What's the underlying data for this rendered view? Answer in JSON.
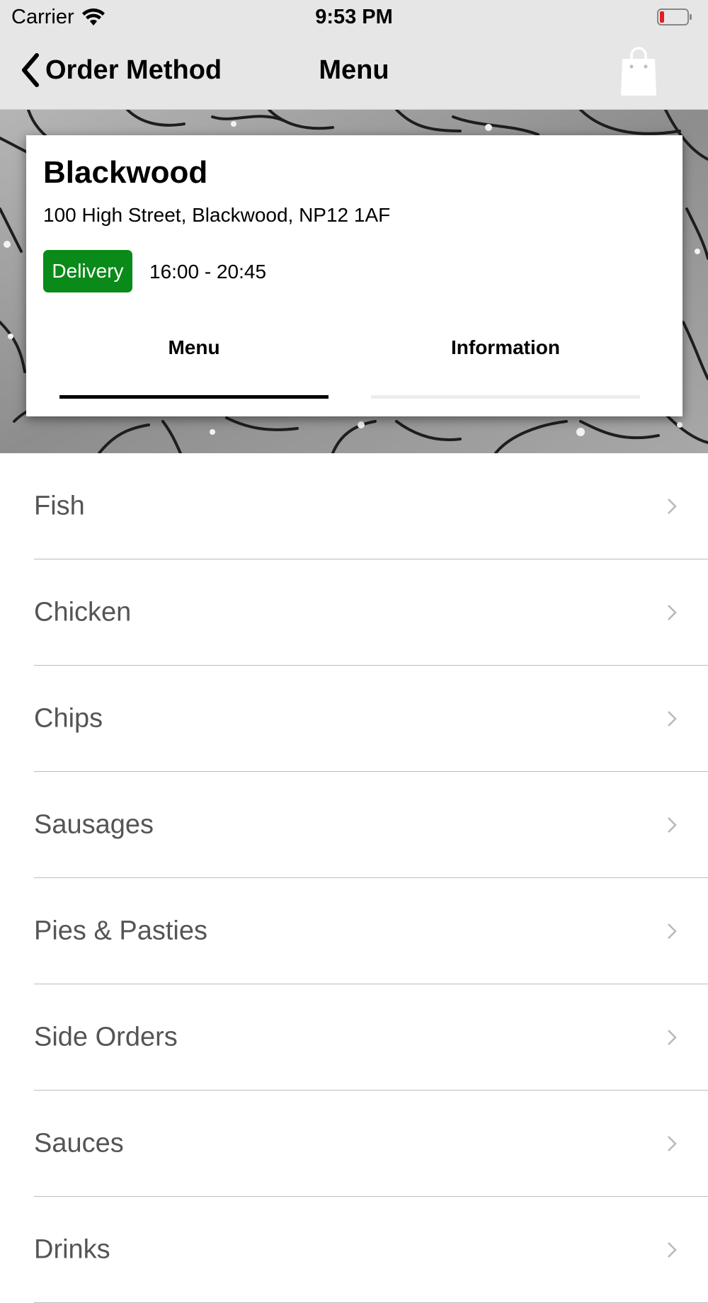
{
  "status_bar": {
    "carrier": "Carrier",
    "time": "9:53 PM"
  },
  "nav": {
    "back_label": "Order Method",
    "title": "Menu"
  },
  "store": {
    "name": "Blackwood",
    "address": "100 High Street, Blackwood, NP12 1AF",
    "badge": "Delivery",
    "hours": "16:00 - 20:45"
  },
  "tabs": [
    {
      "label": "Menu",
      "active": true
    },
    {
      "label": "Information",
      "active": false
    }
  ],
  "categories": [
    "Fish",
    "Chicken",
    "Chips",
    "Sausages",
    "Pies & Pasties",
    "Side Orders",
    "Sauces",
    "Drinks"
  ],
  "colors": {
    "badge_green": "#0a8a19",
    "nav_bg": "#e6e6e6",
    "battery_low": "#e02020"
  },
  "icons": {
    "back": "chevron-left-icon",
    "cart": "shopping-bag-icon",
    "row": "chevron-right-icon",
    "wifi": "wifi-icon",
    "battery": "battery-icon"
  }
}
